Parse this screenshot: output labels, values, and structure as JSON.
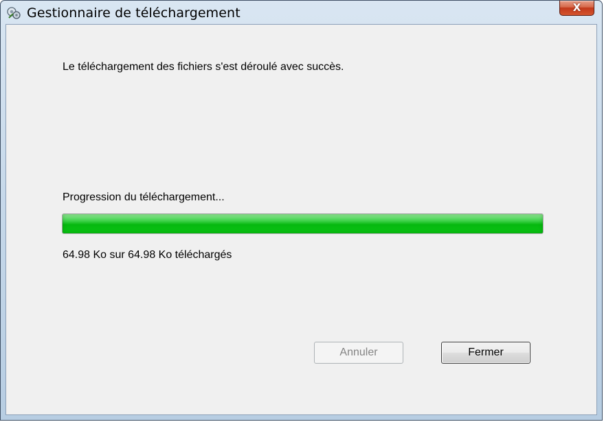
{
  "window": {
    "title": "Gestionnaire de téléchargement",
    "icon": "download-manager-icon",
    "close_glyph": "X"
  },
  "main": {
    "message": "Le téléchargement des fichiers s'est déroulé avec succès.",
    "progress_label": "Progression du téléchargement...",
    "progress_fraction": 1.0,
    "size_status": "64.98 Ko sur 64.98 Ko téléchargés"
  },
  "buttons": {
    "cancel_label": "Annuler",
    "cancel_enabled": false,
    "close_label": "Fermer"
  },
  "colors": {
    "progress_green": "#06b80f",
    "close_red": "#c2391b"
  }
}
